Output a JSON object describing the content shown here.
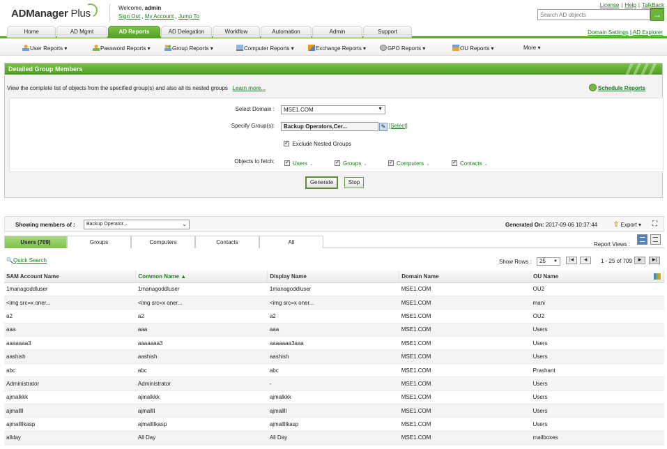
{
  "header": {
    "logo_text": "ADManager",
    "logo_plus": " Plus",
    "welcome_prefix": "Welcome,",
    "user": "admin",
    "sign_out": "Sign Out",
    "my_account": "My Account",
    "jump_to": "Jump To",
    "links": [
      "License",
      "Help",
      "TalkBack"
    ],
    "search_placeholder": "Search AD objects",
    "search_go": "→"
  },
  "tabs": [
    "Home",
    "AD Mgmt",
    "AD Reports",
    "AD Delegation",
    "Workflow",
    "Automation",
    "Admin",
    "Support"
  ],
  "tab_links": {
    "domain_settings": "Domain Settings",
    "ad_explorer": "AD Explorer"
  },
  "submenu": [
    "User Reports ▾",
    "Password Reports ▾",
    "Group Reports ▾",
    "Computer Reports ▾",
    "Exchange Reports ▾",
    "GPO Reports ▾",
    "OU Reports ▾",
    "More ▾"
  ],
  "panel": {
    "title": "Detailed Group Members",
    "description": "View the complete list of objects from the specified group(s) and also all its nested groups",
    "learn_more": "Learn more...",
    "schedule": "Schedule Reports",
    "domain_label": "Select Domain :",
    "domain_value": "MSE1.COM",
    "groups_label": "Specify Group(s):",
    "groups_value": "Backup Operators,Cer...",
    "select_link": "[Select]",
    "exclude_label": "Exclude Nested Groups",
    "fetch_label": "Objects to fetch:",
    "fetch": [
      "Users",
      "Groups",
      "Computers",
      "Contacts"
    ],
    "generate": "Generate",
    "stop": "Stop"
  },
  "results": {
    "showing_label": "Showing members of :",
    "group_select": "Backup Operator...",
    "generated_label": "Generated On:",
    "generated_value": "2017-09-06 10:37:44",
    "export": "Export ▾",
    "tabs": [
      "Users (709)",
      "Groups",
      "Computers",
      "Contacts",
      "All"
    ],
    "report_views": "Report Views :",
    "quick_search": "Quick Search",
    "show_rows_label": "Show Rows :",
    "show_rows_value": "25",
    "page_info": "1 - 25 of 709",
    "columns": [
      "SAM Account Name",
      "Common Name ▲",
      "Display Name",
      "Domain Name",
      "OU Name"
    ],
    "rows": [
      [
        "1managoddluser",
        "1managoddluser",
        "1managoddluser",
        "MSE1.COM",
        "OU2"
      ],
      [
        "<img src=x oner...",
        "<img src=x oner...",
        "<img src=x oner...",
        "MSE1.COM",
        "mani"
      ],
      [
        "a2",
        "a2",
        "a2",
        "MSE1.COM",
        "OU2"
      ],
      [
        "aaa",
        "aaa",
        "aaa",
        "MSE1.COM",
        "Users"
      ],
      [
        "aaaaaaa3",
        "aaaaaaa3",
        "aaaaaaa3aaa",
        "MSE1.COM",
        "Users"
      ],
      [
        "aashish",
        "aashish",
        "aashish",
        "MSE1.COM",
        "Users"
      ],
      [
        "abc",
        "abc",
        "abc",
        "MSE1.COM",
        "Prashant"
      ],
      [
        "Administrator",
        "Administrator",
        "-",
        "MSE1.COM",
        "Users"
      ],
      [
        "ajmalkkk",
        "ajmalkkk",
        "ajmalkkk",
        "MSE1.COM",
        "Users"
      ],
      [
        "ajmallll",
        "ajmallll",
        "ajmallll",
        "MSE1.COM",
        "Users"
      ],
      [
        "ajmallllkasp",
        "ajmallllkasp",
        "ajmallllkasp",
        "MSE1.COM",
        "Users"
      ],
      [
        "allday",
        "All Day",
        "All Day",
        "MSE1.COM",
        "mailboxes"
      ]
    ]
  },
  "colors": {
    "accent": "#5aa82c",
    "link": "#1d7a1d",
    "header_green": "#4e9e23"
  }
}
